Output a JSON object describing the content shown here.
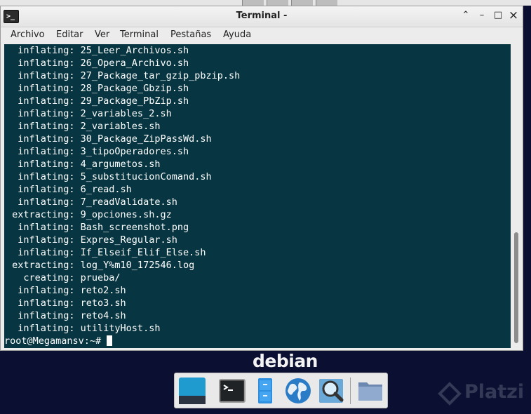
{
  "window": {
    "title": "Terminal -",
    "controls": {
      "minimize": "–",
      "maximize": "□",
      "close": "×",
      "shade": "⌃"
    }
  },
  "menu": [
    "Archivo",
    "Editar",
    "Ver",
    "Terminal",
    "Pestañas",
    "Ayuda"
  ],
  "terminal": {
    "background": "#073642",
    "lines": [
      "  inflating: 25_Leer_Archivos.sh",
      "  inflating: 26_Opera_Archivo.sh",
      "  inflating: 27_Package_tar_gzip_pbzip.sh",
      "  inflating: 28_Package_Gbzip.sh",
      "  inflating: 29_Package_PbZip.sh",
      "  inflating: 2_variables_2.sh",
      "  inflating: 2_variables.sh",
      "  inflating: 30_Package_ZipPassWd.sh",
      "  inflating: 3_tipoOperadores.sh",
      "  inflating: 4_argumetos.sh",
      "  inflating: 5_substitucionComand.sh",
      "  inflating: 6_read.sh",
      "  inflating: 7_readValidate.sh",
      " extracting: 9_opciones.sh.gz",
      "  inflating: Bash_screenshot.png",
      "  inflating: Expres_Regular.sh",
      "  inflating: If_Elseif_Elif_Else.sh",
      " extracting: log_Y%m10_172546.log",
      "   creating: prueba/",
      "  inflating: reto2.sh",
      "  inflating: reto3.sh",
      "  inflating: reto4.sh",
      "  inflating: utilityHost.sh"
    ],
    "prompt": "root@Megamansv:~# "
  },
  "desktop": {
    "logo_text": "debian",
    "watermark": "Platzi",
    "dock_items": [
      "show-desktop",
      "terminal",
      "file-manager",
      "web-browser",
      "app-finder",
      "files-folder"
    ]
  },
  "colors": {
    "terminal_bg": "#073642",
    "desktop_bg": "#0b1033",
    "text": "#ffffff"
  }
}
